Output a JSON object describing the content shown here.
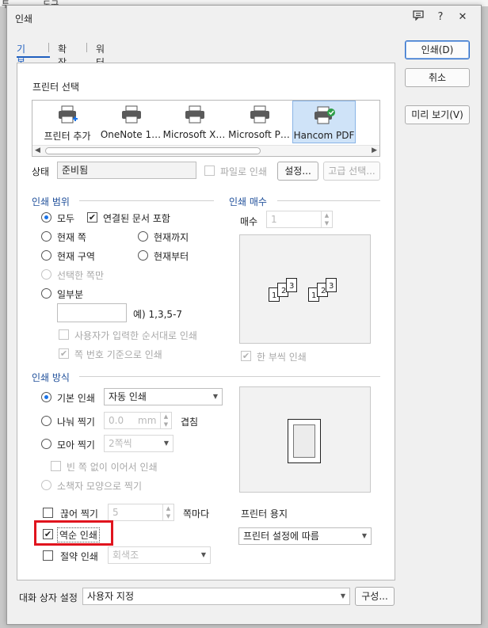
{
  "background": {
    "left_text": "투",
    "right_text": "도구"
  },
  "window": {
    "title": "인쇄",
    "help": "?",
    "close": "✕"
  },
  "tabs": [
    {
      "label": "기본",
      "active": true
    },
    {
      "label": "확장",
      "active": false
    },
    {
      "label": "워터마크",
      "active": false
    }
  ],
  "buttons": {
    "print": "인쇄(D)",
    "cancel": "취소",
    "preview": "미리 보기(V)"
  },
  "printer_select": {
    "heading": "프린터 선택",
    "printers": [
      {
        "name": "프린터 추가",
        "selected": false
      },
      {
        "name": "OneNote 1…",
        "selected": false
      },
      {
        "name": "Microsoft X…",
        "selected": false
      },
      {
        "name": "Microsoft P…",
        "selected": false
      },
      {
        "name": "Hancom PDF",
        "selected": true
      }
    ]
  },
  "status": {
    "label": "상태",
    "value": "준비됨",
    "file_print": "파일로 인쇄",
    "settings": "설정...",
    "advanced": "고급 선택..."
  },
  "print_range": {
    "heading": "인쇄 범위",
    "all": "모두",
    "include_linked": "연결된 문서 포함",
    "current_page": "현재 쪽",
    "to_current": "현재까지",
    "current_section": "현재 구역",
    "from_current": "현재부터",
    "selected_pages": "선택한 쪽만",
    "some": "일부분",
    "example": "예) 1,3,5-7",
    "user_order": "사용자가 입력한 순서대로 인쇄",
    "by_page_number": "쪽 번호 기준으로 인쇄"
  },
  "copies": {
    "heading": "인쇄 매수",
    "label": "매수",
    "value": "1",
    "collate": "한 부씩 인쇄"
  },
  "print_method": {
    "heading": "인쇄 방식",
    "basic": "기본 인쇄",
    "basic_mode": "자동 인쇄",
    "split": "나눠 찍기",
    "split_value": "0.0",
    "split_unit": "mm",
    "overlap": "겹침",
    "collect": "모아 찍기",
    "collect_value": "2쪽씩",
    "no_blank": "빈 쪽 없이 이어서 인쇄",
    "booklet": "소책자 모양으로 찍기",
    "cut": "끊어 찍기",
    "cut_value": "5",
    "cut_unit": "쪽마다",
    "reverse": "역순 인쇄",
    "save": "절약 인쇄",
    "save_mode": "회색조"
  },
  "paper": {
    "heading": "프린터 용지",
    "value": "프린터 설정에 따름"
  },
  "dialog_settings": {
    "label": "대화 상자 설정",
    "value": "사용자 지정",
    "configure": "구성..."
  },
  "colors": {
    "accent": "#1a73e8",
    "highlight": "#e0141e"
  }
}
